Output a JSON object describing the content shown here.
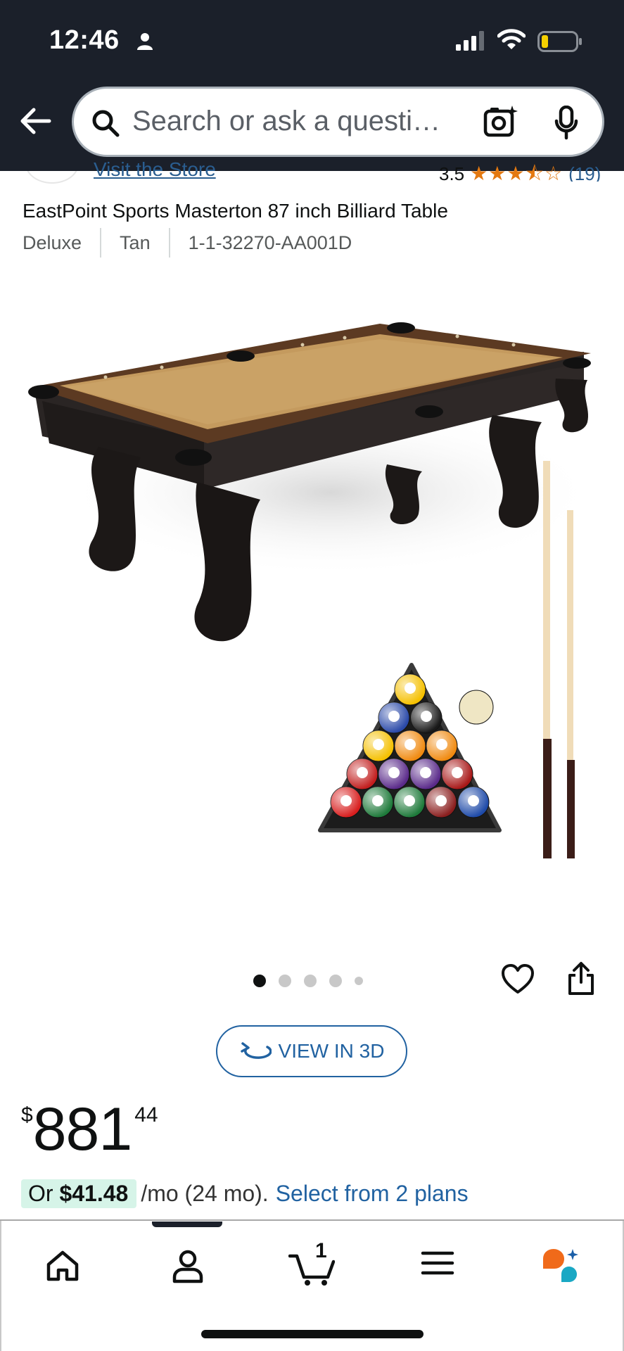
{
  "status_bar": {
    "time": "12:46"
  },
  "search": {
    "placeholder": "Search or ask a questi…"
  },
  "store": {
    "visit_label": "Visit the Store",
    "rating_value": "3.5",
    "rating_stars": 3.5,
    "rating_count": "(19)"
  },
  "product": {
    "title": "EastPoint Sports Masterton 87 inch Billiard Table",
    "variants": [
      "Deluxe",
      "Tan",
      "1-1-32270-AA001D"
    ]
  },
  "carousel": {
    "total_images": 5,
    "active_index": 0
  },
  "view3d": {
    "label": "VIEW IN 3D"
  },
  "price": {
    "symbol": "$",
    "whole": "881",
    "fraction": "44"
  },
  "installment": {
    "prefix": "Or ",
    "amount": "$41.48",
    "term": "/mo (24 mo).",
    "link": "Select from 2 plans"
  },
  "bottom_nav": {
    "cart_count": "1",
    "items": [
      "home-icon",
      "account-icon",
      "cart-icon",
      "menu-icon",
      "rufus-icon"
    ]
  },
  "colors": {
    "header_bg": "#1b202a",
    "link": "#2162a1",
    "star": "#e47911",
    "installment_bg": "#d6f4e8",
    "felt": "#c49a5e"
  }
}
